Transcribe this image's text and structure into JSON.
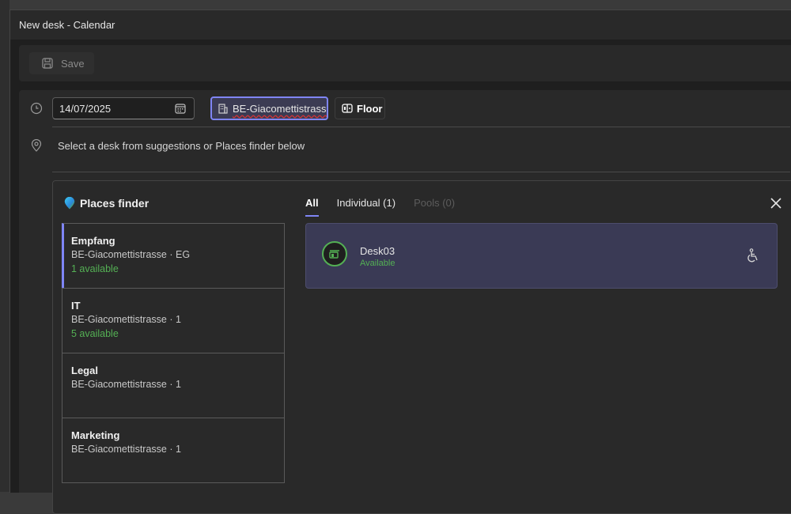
{
  "window": {
    "title": "New desk - Calendar"
  },
  "toolbar": {
    "save_label": "Save"
  },
  "form": {
    "date_value": "14/07/2025",
    "building_label": "BE-Giacomettistrasse",
    "floor_label": "Floor",
    "hint": "Select a desk from suggestions or Places finder below"
  },
  "places_finder": {
    "title": "Places finder",
    "locations": [
      {
        "name": "Empfang",
        "sub": "BE-Giacomettistrasse · EG",
        "availability": "1 available",
        "selected": true
      },
      {
        "name": "IT",
        "sub": "BE-Giacomettistrasse · 1",
        "availability": "5 available",
        "selected": false
      },
      {
        "name": "Legal",
        "sub": "BE-Giacomettistrasse · 1",
        "availability": "",
        "selected": false
      },
      {
        "name": "Marketing",
        "sub": "BE-Giacomettistrasse · 1",
        "availability": "",
        "selected": false
      }
    ],
    "tabs": [
      {
        "label": "All",
        "state": "active"
      },
      {
        "label": "Individual (1)",
        "state": "normal"
      },
      {
        "label": "Pools (0)",
        "state": "disabled"
      }
    ],
    "results": [
      {
        "name": "Desk03",
        "status": "Available",
        "icon": "desk-icon",
        "feature_icon": "accessible-icon"
      }
    ]
  },
  "colors": {
    "accent": "#7f85f5",
    "available": "#54b054",
    "spellcheck": "#d13438"
  }
}
